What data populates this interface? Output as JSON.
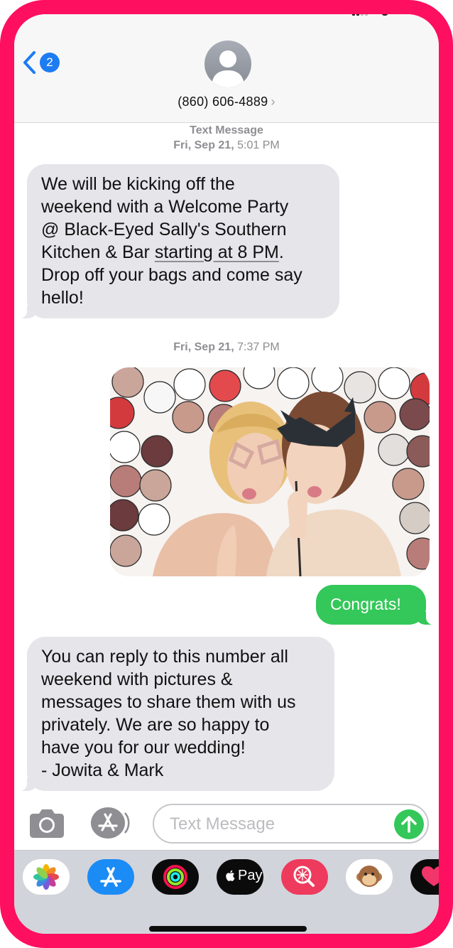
{
  "header": {
    "back_badge": "2",
    "contact": "(860) 606-4889",
    "contact_chevron": "›"
  },
  "conversation": {
    "service_label": "Text Message",
    "timestamp1_day": "Fri, Sep 21,",
    "timestamp1_time": "5:01 PM",
    "message1_part1": "We will be kicking off the\nweekend with a Welcome Party\n@ Black-Eyed Sally's Southern\nKitchen & Bar ",
    "message1_link": "starting at 8 PM",
    "message1_part2": ".\nDrop off your bags and come say\nhello!",
    "timestamp2_day": "Fri, Sep 21,",
    "timestamp2_time": "7:37 PM",
    "sent_message": "Congrats!",
    "message2": "You can reply to this number all\nweekend with pictures &\nmessages to share them with us\nprivately. We are so happy to\nhave you for our wedding!\n- Jowita & Mark"
  },
  "input_bar": {
    "placeholder": "Text Message"
  },
  "drawer": {
    "apps": [
      "photos-icon",
      "app-store-icon",
      "activity-icon",
      "apple-pay-icon",
      "search-images-icon",
      "animoji-icon",
      "digital-touch-icon"
    ],
    "apple_pay_label": "Pay"
  },
  "colors": {
    "accent_blue": "#1d7cf2",
    "imessage_green": "#34c759",
    "incoming_bubble": "#e5e5ea",
    "frame_pink": "#ff0f5f"
  }
}
